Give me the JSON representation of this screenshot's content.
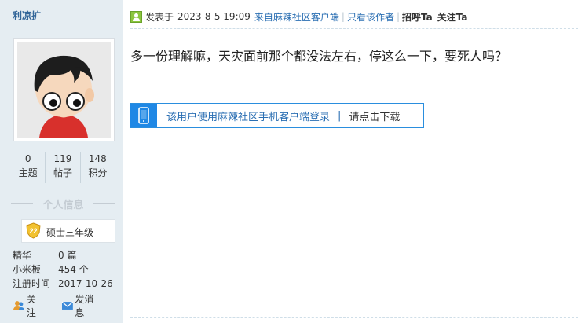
{
  "author": {
    "username": "利凉扩",
    "stats": [
      {
        "value": "0",
        "label": "主题"
      },
      {
        "value": "119",
        "label": "帖子"
      },
      {
        "value": "148",
        "label": "积分"
      }
    ],
    "section_title": "个人信息",
    "rank": {
      "level": "22",
      "title": "硕士三年级"
    },
    "profile": [
      {
        "key": "精华",
        "value": "0 篇"
      },
      {
        "key": "小米板",
        "value": "454 个"
      },
      {
        "key": "注册时间",
        "value": "2017-10-26"
      }
    ],
    "actions": {
      "follow": "关注",
      "message": "发消息"
    }
  },
  "post": {
    "posted_prefix": "发表于",
    "posted_at": "2023-8-5 19:09",
    "source": "来自麻辣社区客户端",
    "only_author": "只看该作者",
    "greet": "招呼Ta",
    "follow": "关注Ta",
    "content": "多一份理解嘛，天灾面前那个都没法左右，停这么一下，要死人吗？",
    "mobile_prompt": "该用户使用麻辣社区手机客户端登录",
    "download_prompt": "请点击下载"
  },
  "colors": {
    "sidebar_bg": "#e5edf2",
    "link": "#336699",
    "client_link": "#2b6fb3",
    "mobile_accent": "#1f88e5"
  }
}
